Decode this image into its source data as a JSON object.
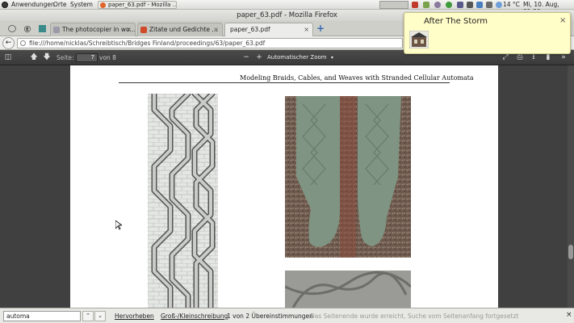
{
  "panel": {
    "menus": [
      "Anwendungen",
      "Orte",
      "System"
    ],
    "task": "paper_63.pdf - Mozilla ...",
    "weather": "14 °C",
    "clock": "Mi, 10. Aug, 01:30"
  },
  "window": {
    "title": "paper_63.pdf - Mozilla Firefox"
  },
  "tabs": [
    {
      "label": "The photocopier in wo...",
      "close": "×"
    },
    {
      "label": "Zitate und Gedichte ...",
      "close": "×"
    },
    {
      "label": "paper_63.pdf",
      "close": "×"
    }
  ],
  "newtab": "+",
  "url": "file:///home/nicklas/Schreibtisch/Bridges Finland/proceedings/63/paper_63.pdf",
  "pdf_toolbar": {
    "page_label": "Seite:",
    "page_value": "7",
    "page_of": "von 8",
    "zoom": "Automatischer Zoom"
  },
  "page": {
    "running_header": "Modeling Braids, Cables, and Weaves with Stranded Cellular Automata"
  },
  "findbar": {
    "value": "automa",
    "highlight_all": "Hervorheben",
    "match_case": "Groß-/Kleinschreibung",
    "matches": "1 von 2 Übereinstimmungen",
    "status": "Das Seitenende wurde erreicht, Suche vom Seitenanfang fortgesetzt"
  },
  "notification": {
    "title": "After The Storm",
    "close": "×"
  },
  "colors": {
    "firefox_pdf_toolbar": "#3a3a3a",
    "viewer_background": "#404040",
    "sock_green": "#7f9482",
    "notification_bg": "#fffdc8"
  }
}
